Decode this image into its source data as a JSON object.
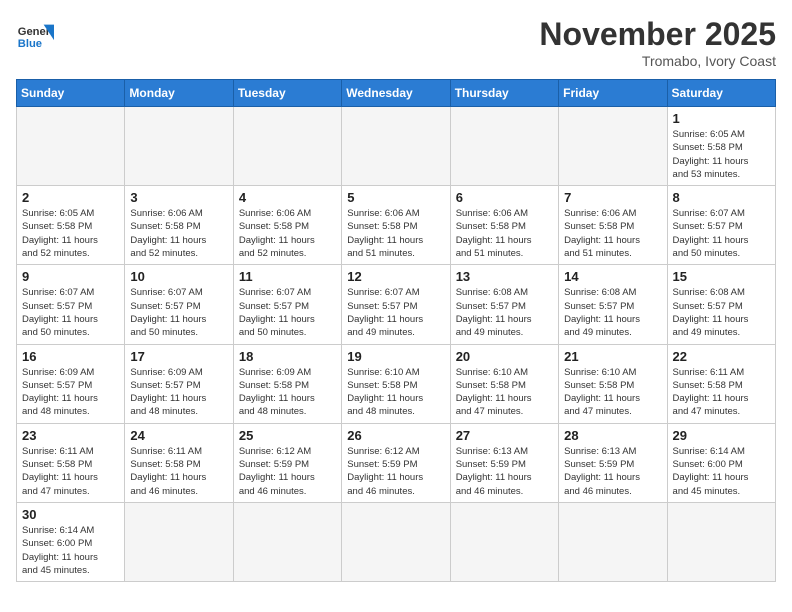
{
  "header": {
    "logo_general": "General",
    "logo_blue": "Blue",
    "month": "November 2025",
    "location": "Tromabo, Ivory Coast"
  },
  "weekdays": [
    "Sunday",
    "Monday",
    "Tuesday",
    "Wednesday",
    "Thursday",
    "Friday",
    "Saturday"
  ],
  "days": [
    {
      "date": "",
      "info": ""
    },
    {
      "date": "",
      "info": ""
    },
    {
      "date": "",
      "info": ""
    },
    {
      "date": "",
      "info": ""
    },
    {
      "date": "",
      "info": ""
    },
    {
      "date": "",
      "info": ""
    },
    {
      "date": "1",
      "info": "Sunrise: 6:05 AM\nSunset: 5:58 PM\nDaylight: 11 hours\nand 53 minutes."
    },
    {
      "date": "2",
      "info": "Sunrise: 6:05 AM\nSunset: 5:58 PM\nDaylight: 11 hours\nand 52 minutes."
    },
    {
      "date": "3",
      "info": "Sunrise: 6:06 AM\nSunset: 5:58 PM\nDaylight: 11 hours\nand 52 minutes."
    },
    {
      "date": "4",
      "info": "Sunrise: 6:06 AM\nSunset: 5:58 PM\nDaylight: 11 hours\nand 52 minutes."
    },
    {
      "date": "5",
      "info": "Sunrise: 6:06 AM\nSunset: 5:58 PM\nDaylight: 11 hours\nand 51 minutes."
    },
    {
      "date": "6",
      "info": "Sunrise: 6:06 AM\nSunset: 5:58 PM\nDaylight: 11 hours\nand 51 minutes."
    },
    {
      "date": "7",
      "info": "Sunrise: 6:06 AM\nSunset: 5:58 PM\nDaylight: 11 hours\nand 51 minutes."
    },
    {
      "date": "8",
      "info": "Sunrise: 6:07 AM\nSunset: 5:57 PM\nDaylight: 11 hours\nand 50 minutes."
    },
    {
      "date": "9",
      "info": "Sunrise: 6:07 AM\nSunset: 5:57 PM\nDaylight: 11 hours\nand 50 minutes."
    },
    {
      "date": "10",
      "info": "Sunrise: 6:07 AM\nSunset: 5:57 PM\nDaylight: 11 hours\nand 50 minutes."
    },
    {
      "date": "11",
      "info": "Sunrise: 6:07 AM\nSunset: 5:57 PM\nDaylight: 11 hours\nand 50 minutes."
    },
    {
      "date": "12",
      "info": "Sunrise: 6:07 AM\nSunset: 5:57 PM\nDaylight: 11 hours\nand 49 minutes."
    },
    {
      "date": "13",
      "info": "Sunrise: 6:08 AM\nSunset: 5:57 PM\nDaylight: 11 hours\nand 49 minutes."
    },
    {
      "date": "14",
      "info": "Sunrise: 6:08 AM\nSunset: 5:57 PM\nDaylight: 11 hours\nand 49 minutes."
    },
    {
      "date": "15",
      "info": "Sunrise: 6:08 AM\nSunset: 5:57 PM\nDaylight: 11 hours\nand 49 minutes."
    },
    {
      "date": "16",
      "info": "Sunrise: 6:09 AM\nSunset: 5:57 PM\nDaylight: 11 hours\nand 48 minutes."
    },
    {
      "date": "17",
      "info": "Sunrise: 6:09 AM\nSunset: 5:57 PM\nDaylight: 11 hours\nand 48 minutes."
    },
    {
      "date": "18",
      "info": "Sunrise: 6:09 AM\nSunset: 5:58 PM\nDaylight: 11 hours\nand 48 minutes."
    },
    {
      "date": "19",
      "info": "Sunrise: 6:10 AM\nSunset: 5:58 PM\nDaylight: 11 hours\nand 48 minutes."
    },
    {
      "date": "20",
      "info": "Sunrise: 6:10 AM\nSunset: 5:58 PM\nDaylight: 11 hours\nand 47 minutes."
    },
    {
      "date": "21",
      "info": "Sunrise: 6:10 AM\nSunset: 5:58 PM\nDaylight: 11 hours\nand 47 minutes."
    },
    {
      "date": "22",
      "info": "Sunrise: 6:11 AM\nSunset: 5:58 PM\nDaylight: 11 hours\nand 47 minutes."
    },
    {
      "date": "23",
      "info": "Sunrise: 6:11 AM\nSunset: 5:58 PM\nDaylight: 11 hours\nand 47 minutes."
    },
    {
      "date": "24",
      "info": "Sunrise: 6:11 AM\nSunset: 5:58 PM\nDaylight: 11 hours\nand 46 minutes."
    },
    {
      "date": "25",
      "info": "Sunrise: 6:12 AM\nSunset: 5:59 PM\nDaylight: 11 hours\nand 46 minutes."
    },
    {
      "date": "26",
      "info": "Sunrise: 6:12 AM\nSunset: 5:59 PM\nDaylight: 11 hours\nand 46 minutes."
    },
    {
      "date": "27",
      "info": "Sunrise: 6:13 AM\nSunset: 5:59 PM\nDaylight: 11 hours\nand 46 minutes."
    },
    {
      "date": "28",
      "info": "Sunrise: 6:13 AM\nSunset: 5:59 PM\nDaylight: 11 hours\nand 46 minutes."
    },
    {
      "date": "29",
      "info": "Sunrise: 6:14 AM\nSunset: 6:00 PM\nDaylight: 11 hours\nand 45 minutes."
    },
    {
      "date": "30",
      "info": "Sunrise: 6:14 AM\nSunset: 6:00 PM\nDaylight: 11 hours\nand 45 minutes."
    },
    {
      "date": "",
      "info": ""
    },
    {
      "date": "",
      "info": ""
    },
    {
      "date": "",
      "info": ""
    },
    {
      "date": "",
      "info": ""
    },
    {
      "date": "",
      "info": ""
    },
    {
      "date": "",
      "info": ""
    }
  ]
}
